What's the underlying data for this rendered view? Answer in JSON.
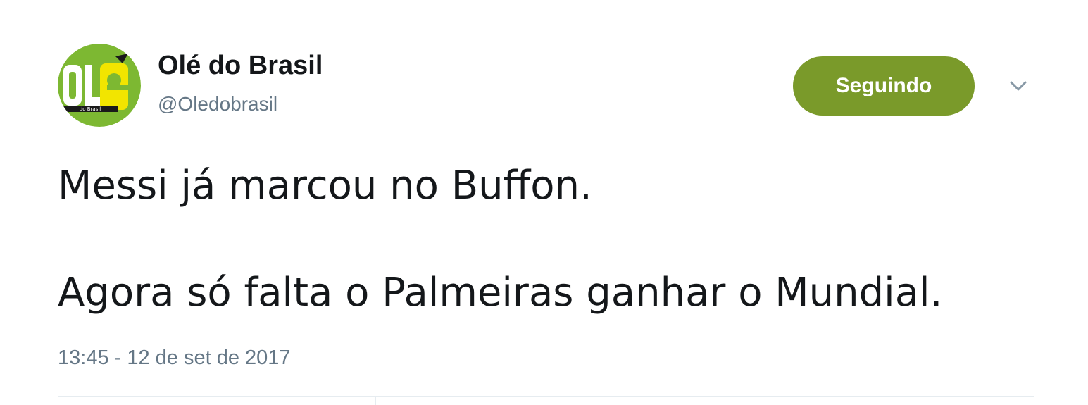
{
  "tweet": {
    "author": {
      "display_name": "Olé do Brasil",
      "handle": "@Oledobrasil",
      "avatar_icon": "ole-do-brasil-logo",
      "avatar_colors": {
        "background": "#7db832",
        "accent": "#f2e500",
        "text": "#ffffff"
      },
      "avatar_logo_text": "OLé",
      "avatar_logo_subtext": "do Brasil"
    },
    "follow_button": {
      "label": "Seguindo",
      "color": "#7a9a2a"
    },
    "menu_icon": "chevron-down-icon",
    "text_lines": [
      "Messi já marcou no Buffon.",
      "Agora só falta o Palmeiras ganhar o Mundial."
    ],
    "timestamp": "13:45 - 12 de set de 2017"
  }
}
